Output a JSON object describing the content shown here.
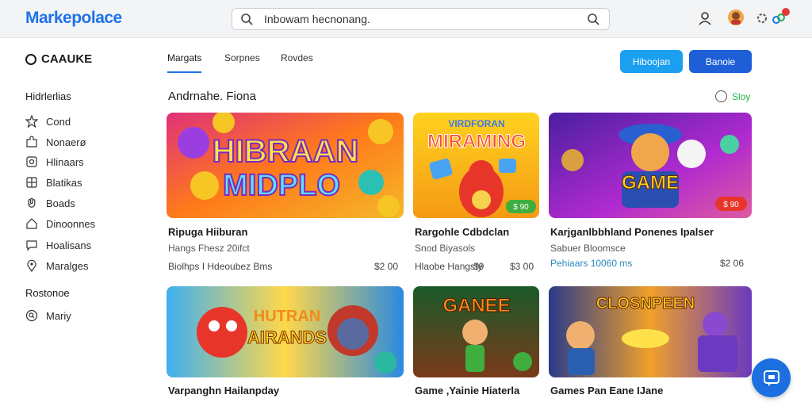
{
  "header": {
    "logo": "Markepolace",
    "search_value": "Inbowam hecnonang."
  },
  "sidebar": {
    "brand": "CAAUKE",
    "section1": "Hidrlerlias",
    "items": [
      {
        "label": "Cond",
        "icon": "star-icon"
      },
      {
        "label": "Nonaerø",
        "icon": "puzzle-icon"
      },
      {
        "label": "Hlinaars",
        "icon": "image-icon"
      },
      {
        "label": "Blatikas",
        "icon": "grid-icon"
      },
      {
        "label": "Boads",
        "icon": "hand-icon"
      },
      {
        "label": "Dinoonnes",
        "icon": "home-icon"
      },
      {
        "label": "Hoalisans",
        "icon": "chat-icon"
      },
      {
        "label": "Maralges",
        "icon": "pin-icon"
      }
    ],
    "section2": "Rostonoe",
    "items2": [
      {
        "label": "Mariy",
        "icon": "search-circle-icon"
      }
    ]
  },
  "tabs": [
    "Margats",
    "Sorpnes",
    "Rovdes"
  ],
  "buttons": {
    "primary": "Hiboojan",
    "secondary": "Banoie"
  },
  "section": {
    "heading": "Andrnahe. Fiona",
    "see_all": "Sloy"
  },
  "cards": [
    {
      "title": "Ripuga Hiiburan",
      "subtitle": "Hangs Fhesz 20ifct",
      "meta": "Biolhps I Hdeoubez Bms",
      "price": "$2 00",
      "price2": ""
    },
    {
      "title": "Rargohle Cdbdclan",
      "subtitle": "Snod Biyasols",
      "meta": "Hlaobe Hangsfy",
      "price": "$3 00",
      "price2": "$9",
      "badge": "$ 90"
    },
    {
      "title": "Karjganlbbhland Ponenes Ipalser",
      "subtitle": "Sabuer Bloomsce",
      "meta": "Pehiaars 10060 ms",
      "price": "$2 06",
      "price2": "",
      "badge": "$ 90"
    },
    {
      "title": "Varpanghn Hailanpday",
      "subtitle": "",
      "meta": "",
      "price": "",
      "price2": ""
    },
    {
      "title": "Game ,Yainie Hiaterla",
      "subtitle": "",
      "meta": "",
      "price": "",
      "price2": ""
    },
    {
      "title": "Games Pan Eane IJane",
      "subtitle": "",
      "meta": "",
      "price": "",
      "price2": ""
    }
  ],
  "thumb_text": {
    "c1": [
      "HIBRAAN",
      "MIDPLO"
    ],
    "c2": [
      "VIRDFORAN",
      "MIRAMING"
    ],
    "c3": [
      "GAME"
    ],
    "c4": [
      "HUTRAN",
      "AIRANDS"
    ],
    "c5": [
      "GANEE"
    ],
    "c6": [
      "CLOSNPEEN"
    ]
  },
  "colors": {
    "accent": "#1e73e8",
    "green": "#22b34a"
  }
}
